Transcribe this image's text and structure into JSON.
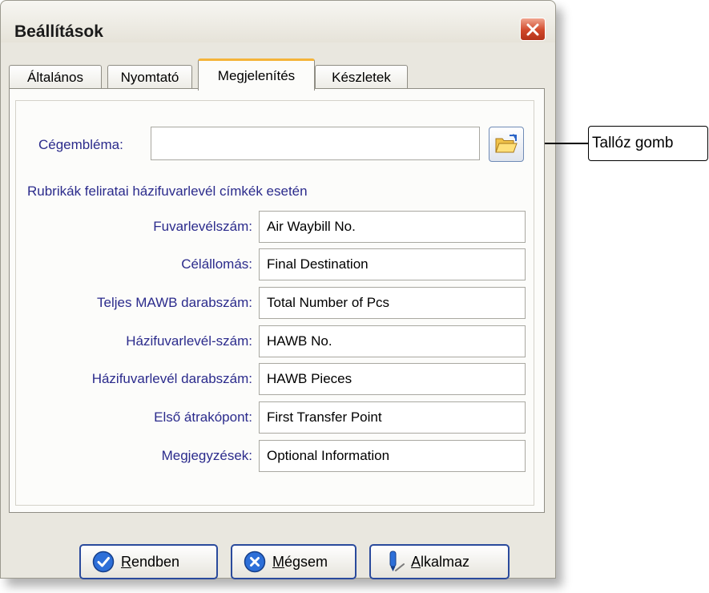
{
  "window": {
    "title": "Beállítások"
  },
  "tabs": [
    {
      "label": "Általános"
    },
    {
      "label": "Nyomtató"
    },
    {
      "label": "Megjelenítés",
      "active": true
    },
    {
      "label": "Készletek"
    }
  ],
  "logo": {
    "label": "Cégembléma:",
    "value": ""
  },
  "section_title": "Rubrikák feliratai házifuvarlevél címkék esetén",
  "fields": [
    {
      "label": "Fuvarlevélszám:",
      "value": "Air Waybill No."
    },
    {
      "label": "Célállomás:",
      "value": "Final Destination"
    },
    {
      "label": "Teljes MAWB darabszám:",
      "value": "Total Number of Pcs"
    },
    {
      "label": "Házifuvarlevél-szám:",
      "value": "HAWB No."
    },
    {
      "label": "Házifuvarlevél darabszám:",
      "value": "HAWB Pieces"
    },
    {
      "label": "Első átrakópont:",
      "value": "First Transfer Point"
    },
    {
      "label": "Megjegyzések:",
      "value": "Optional Information"
    }
  ],
  "callout": {
    "text": "Tallóz gomb"
  },
  "buttons": {
    "ok": {
      "mnemonic": "R",
      "rest": "endben"
    },
    "cancel": {
      "mnemonic": "M",
      "rest": "égsem"
    },
    "apply": {
      "mnemonic": "A",
      "rest": "lkalmaz"
    }
  },
  "colors": {
    "label_text": "#2b2b8c",
    "tab_highlight": "#f4b43a",
    "button_border": "#2a4a9c"
  }
}
